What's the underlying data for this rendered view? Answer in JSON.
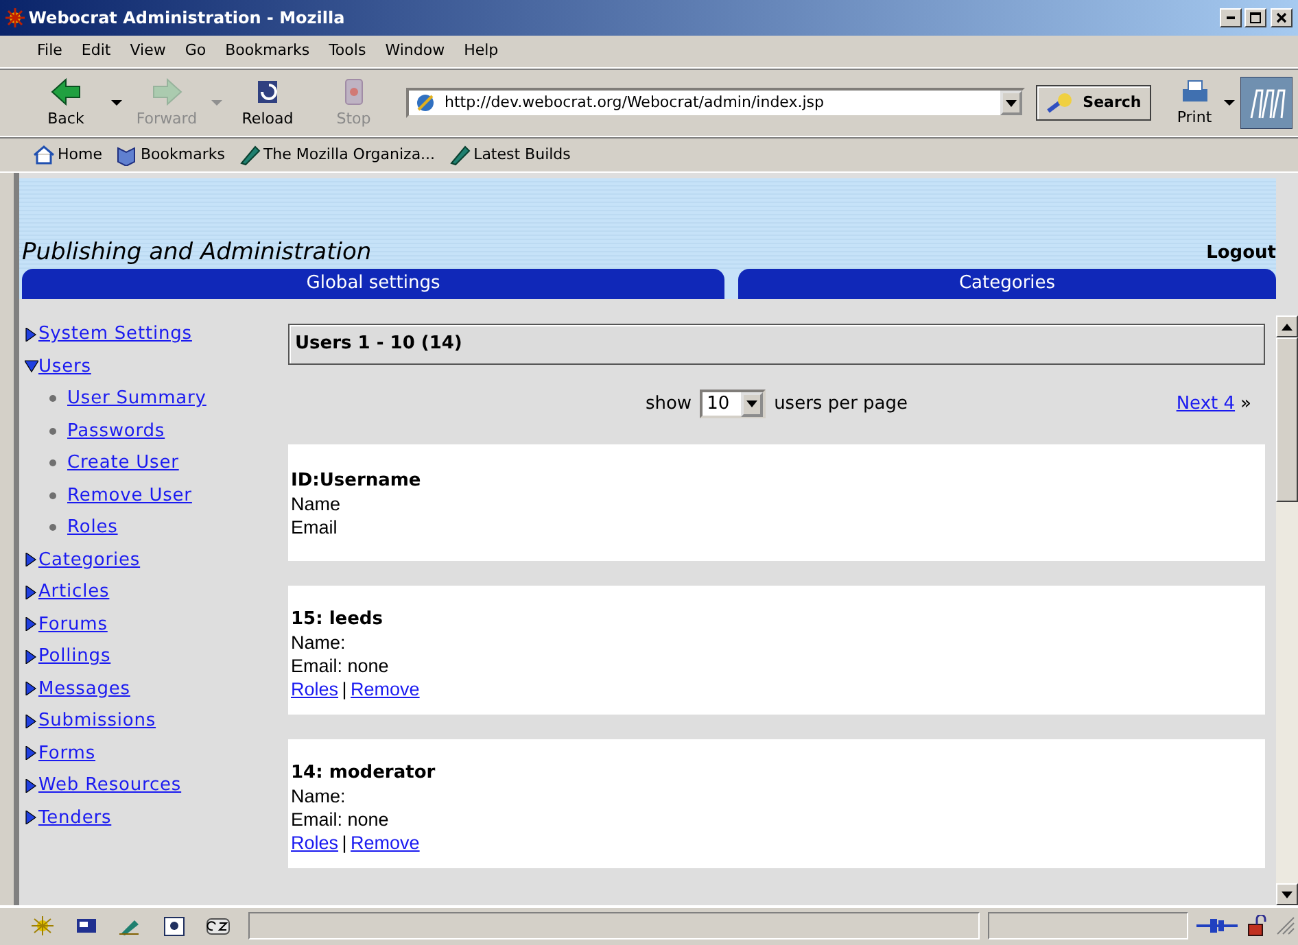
{
  "window": {
    "title": "Webocrat Administration - Mozilla"
  },
  "menu": [
    "File",
    "Edit",
    "View",
    "Go",
    "Bookmarks",
    "Tools",
    "Window",
    "Help"
  ],
  "nav_buttons": [
    {
      "label": "Back",
      "kind": "back",
      "disabled": false,
      "dropdown": true
    },
    {
      "label": "Forward",
      "kind": "forward",
      "disabled": true,
      "dropdown": true
    },
    {
      "label": "Reload",
      "kind": "reload",
      "disabled": false,
      "dropdown": false
    },
    {
      "label": "Stop",
      "kind": "stop",
      "disabled": true,
      "dropdown": false
    }
  ],
  "address": {
    "value": "http://dev.webocrat.org/Webocrat/admin/index.jsp"
  },
  "search_button": "Search",
  "print_button": "Print",
  "bookmarks_bar": [
    {
      "label": "Home",
      "kind": "home"
    },
    {
      "label": "Bookmarks",
      "kind": "bookmarks"
    },
    {
      "label": "The Mozilla Organiza...",
      "kind": "link"
    },
    {
      "label": "Latest Builds",
      "kind": "link"
    }
  ],
  "page": {
    "title": "Publishing and Administration",
    "logout": "Logout",
    "tabs": [
      "Global settings",
      "Categories"
    ],
    "sidebar": [
      {
        "label": "System Settings",
        "expanded": false
      },
      {
        "label": "Users",
        "expanded": true,
        "children": [
          "User Summary",
          "Passwords",
          "Create User",
          "Remove User",
          "Roles"
        ]
      },
      {
        "label": "Categories",
        "expanded": false
      },
      {
        "label": "Articles",
        "expanded": false
      },
      {
        "label": "Forums",
        "expanded": false
      },
      {
        "label": "Pollings",
        "expanded": false
      },
      {
        "label": "Messages",
        "expanded": false
      },
      {
        "label": "Submissions",
        "expanded": false
      },
      {
        "label": "Forms",
        "expanded": false
      },
      {
        "label": "Web Resources",
        "expanded": false
      },
      {
        "label": "Tenders",
        "expanded": false
      }
    ],
    "users_header": "Users 1 - 10 (14)",
    "pager": {
      "show": "show",
      "per_page_value": "10",
      "per_page_label": "users per page",
      "next": "Next 4",
      "next_mark": "»"
    },
    "cards": [
      {
        "title": "ID:Username",
        "lines": [
          "Name",
          "Email"
        ]
      },
      {
        "title": "15: leeds",
        "lines": [
          "Name:",
          "Email: none"
        ],
        "links": [
          "Roles",
          "Remove"
        ],
        "separator": "|"
      },
      {
        "title": "14: moderator",
        "lines": [
          "Name:",
          "Email: none"
        ],
        "links": [
          "Roles",
          "Remove"
        ],
        "separator": "|"
      }
    ]
  }
}
